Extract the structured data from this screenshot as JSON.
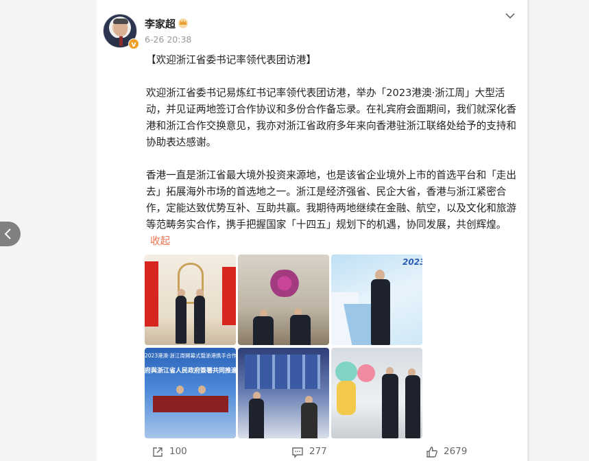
{
  "post": {
    "author": "李家超",
    "timestamp": "6-26 20:38",
    "verified_badge": "v",
    "title": "【欢迎浙江省委书记率领代表团访港】",
    "paragraph1": "欢迎浙江省委书记易炼红书记率领代表团访港，举办「2023港澳·浙江周」大型活动，并见证两地签订合作协议和多份合作备忘录。在礼宾府会面期间，我们就深化香港和浙江合作交换意见，我亦对浙江省政府多年来向香港驻浙江联络处给予的支持和协助表达感谢。",
    "paragraph2": "香港一直是浙江省最大境外投资来源地，也是该省企业境外上市的首选平台和「走出去」拓展海外市场的首选地之一。浙江是经济强省、民企大省，香港与浙江紧密合作，定能达致优势互补、互助共赢。我期待两地继续在金融、航空，以及文化和旅游等范畴务实合作，携手把握国家「十四五」规划下的机遇，协同发展，共创辉煌。",
    "collapse_label": "收起",
    "photo_texts": {
      "ph3_year": "2023",
      "ph4_line1": "2023港澳·浙江周開幕式暨浙港携手合作",
      "ph4_line2": "府與浙江省人民政府簽署共同推進"
    }
  },
  "actions": {
    "repost_count": "100",
    "comment_count": "277",
    "like_count": "2679"
  },
  "icons": [
    "more-chevron-icon",
    "crown-icon",
    "share-icon",
    "comment-icon",
    "like-icon",
    "back-arrow-icon"
  ],
  "colors": {
    "link": "#eb7350",
    "badge": "#f0a028",
    "text": "#222222",
    "meta": "#999999"
  }
}
